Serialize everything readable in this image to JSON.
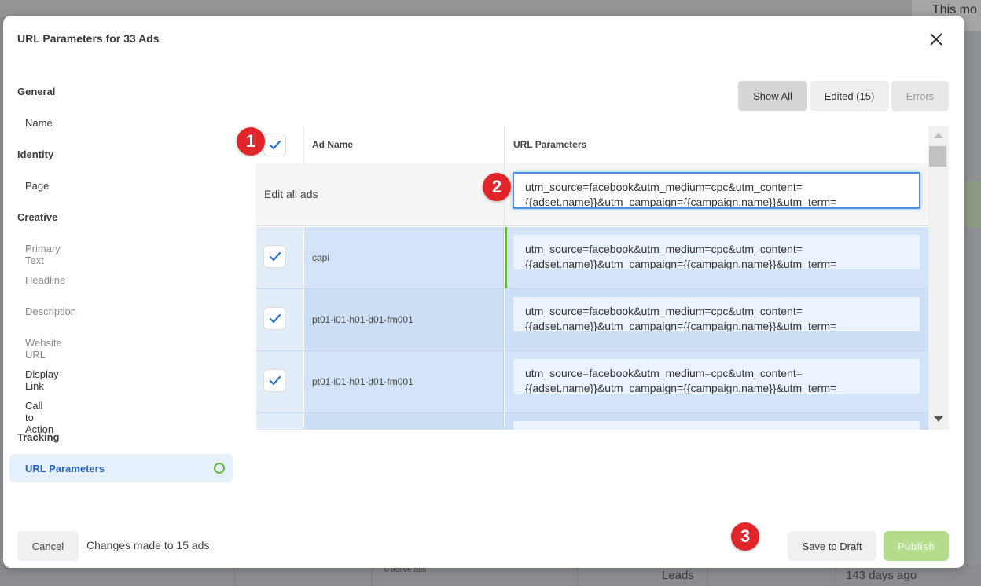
{
  "background": {
    "top_right_text": "This mo",
    "bottom_texts": [
      "0 active ads",
      "Leads",
      "143 days ago"
    ]
  },
  "modal": {
    "title": "URL Parameters for 33 Ads",
    "close_icon": "close-icon"
  },
  "sidebar": {
    "sections": [
      {
        "label": "General",
        "items": [
          {
            "label": "Name",
            "state": "enabled"
          }
        ]
      },
      {
        "label": "Identity",
        "items": [
          {
            "label": "Page",
            "state": "enabled"
          }
        ]
      },
      {
        "label": "Creative",
        "items": [
          {
            "label": "Primary Text",
            "state": "disabled"
          },
          {
            "label": "Headline",
            "state": "disabled"
          },
          {
            "label": "Description",
            "state": "disabled"
          },
          {
            "label": "Website URL",
            "state": "disabled"
          },
          {
            "label": "Display Link",
            "state": "enabled"
          },
          {
            "label": "Call to Action",
            "state": "enabled"
          }
        ]
      },
      {
        "label": "Tracking",
        "items": [
          {
            "label": "URL Parameters",
            "state": "active",
            "status_icon": "circle-ring-icon"
          }
        ]
      }
    ],
    "active_color": "#2966c2",
    "status_color": "#6cb33a"
  },
  "filters": {
    "show_all": "Show All",
    "edited": "Edited (15)",
    "errors": "Errors",
    "selected": "Show All"
  },
  "table": {
    "columns": [
      "Ad Name",
      "URL Parameters"
    ],
    "header_checkbox_checked": true,
    "edit_all": {
      "label": "Edit all ads",
      "value": "utm_source=facebook&utm_medium=cpc&utm_content=\n{{adset.name}}&utm_campaign={{campaign.name}}&utm_term="
    },
    "rows": [
      {
        "checked": true,
        "name": "capi",
        "url_params": "utm_source=facebook&utm_medium=cpc&utm_content=\n{{adset.name}}&utm_campaign={{campaign.name}}&utm_term=",
        "edited": true
      },
      {
        "checked": true,
        "name": "pt01-i01-h01-d01-fm001",
        "url_params": "utm_source=facebook&utm_medium=cpc&utm_content=\n{{adset.name}}&utm_campaign={{campaign.name}}&utm_term=",
        "edited": false
      },
      {
        "checked": true,
        "name": "pt01-i01-h01-d01-fm001",
        "url_params": "utm_source=facebook&utm_medium=cpc&utm_content=\n{{adset.name}}&utm_campaign={{campaign.name}}&utm_term=",
        "edited": false
      },
      {
        "checked": false,
        "name": "",
        "url_params": "",
        "edited": false
      }
    ]
  },
  "footer": {
    "cancel": "Cancel",
    "changes": "Changes made to 15 ads",
    "save_draft": "Save to Draft",
    "publish": "Publish"
  },
  "callouts": [
    "1",
    "2",
    "3"
  ],
  "colors": {
    "accent_blue": "#4a90e2",
    "check_blue": "#2a75d6",
    "publish_green": "#b3dc8c",
    "edited_marker": "#6cb33a",
    "callout_red": "#e0262b"
  }
}
